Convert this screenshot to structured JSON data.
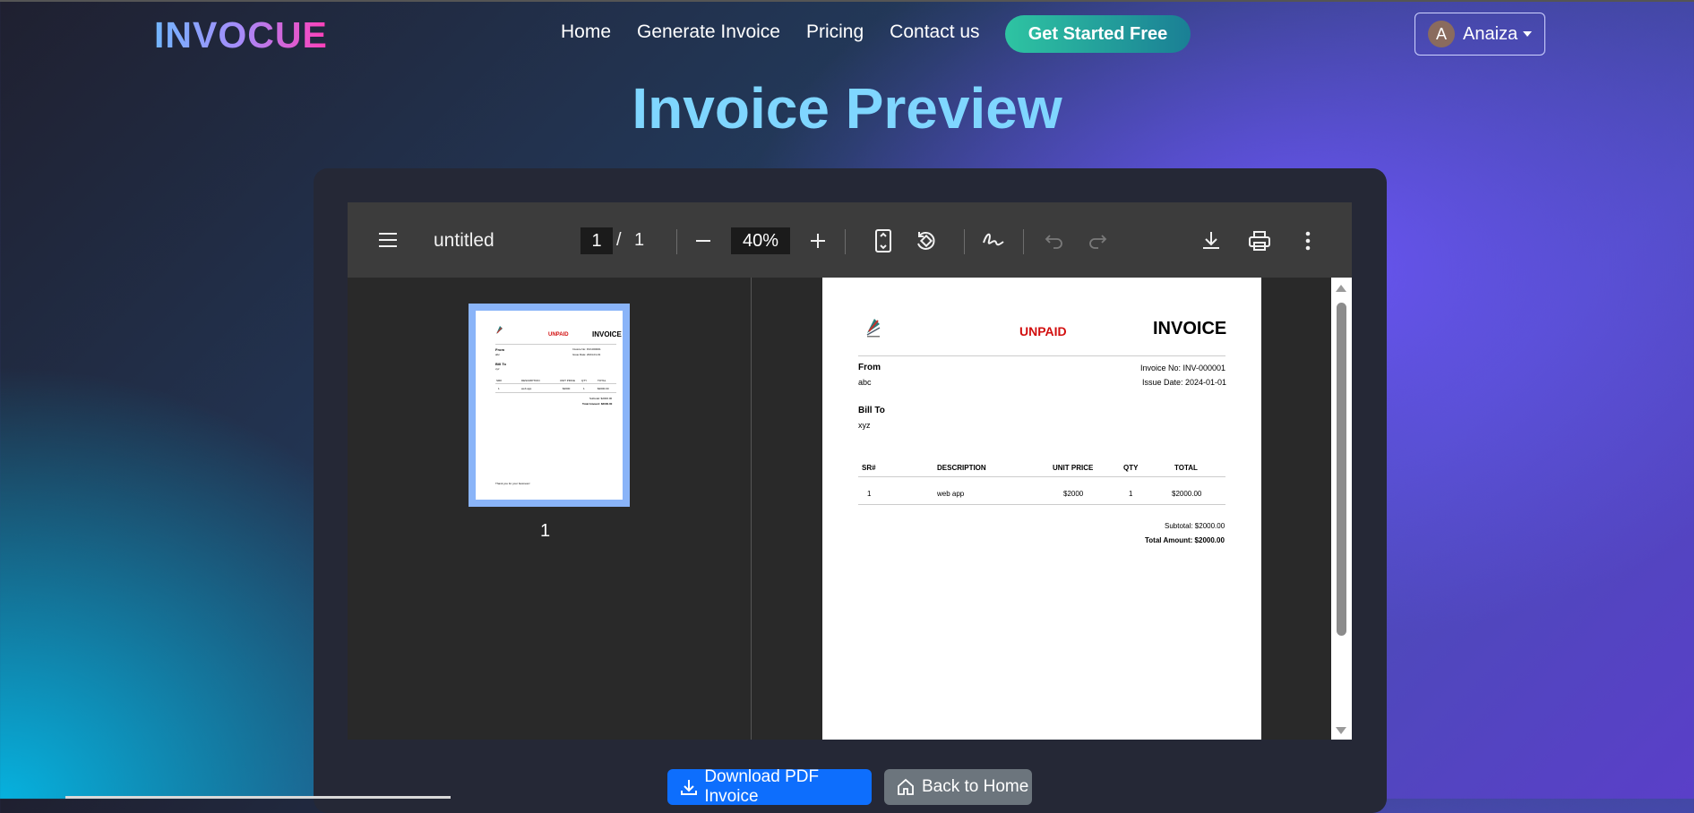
{
  "brand": "INVOCUE",
  "nav": {
    "links": [
      "Home",
      "Generate Invoice",
      "Pricing",
      "Contact us"
    ],
    "cta": "Get Started Free",
    "user_initial": "A",
    "user_name": "Anaiza"
  },
  "page_title": "Invoice Preview",
  "viewer": {
    "doc_title": "untitled",
    "current_page": "1",
    "page_sep": "/",
    "total_pages": "1",
    "zoom": "40%",
    "thumb_label": "1"
  },
  "invoice": {
    "status": "UNPAID",
    "heading": "INVOICE",
    "from_label": "From",
    "from_value": "abc",
    "invoice_no": "Invoice No: INV-000001",
    "issue_date": "Issue Date: 2024-01-01",
    "bill_to_label": "Bill To",
    "bill_to_value": "xyz",
    "columns": [
      "SR#",
      "DESCRIPTION",
      "UNIT PRICE",
      "QTY",
      "TOTAL"
    ],
    "rows": [
      [
        "1",
        "web app",
        "$2000",
        "1",
        "$2000.00"
      ]
    ],
    "subtotal": "Subtotal: $2000.00",
    "total": "Total Amount: $2000.00",
    "thumb_footer": "Thank you for your business!"
  },
  "actions": {
    "download": "Download PDF Invoice",
    "home": "Back to Home"
  },
  "colors": {
    "status_red": "#d20f0f",
    "download_blue": "#0d6efd",
    "home_gray": "#6c757d",
    "title_cyan": "#7fd6ff"
  }
}
